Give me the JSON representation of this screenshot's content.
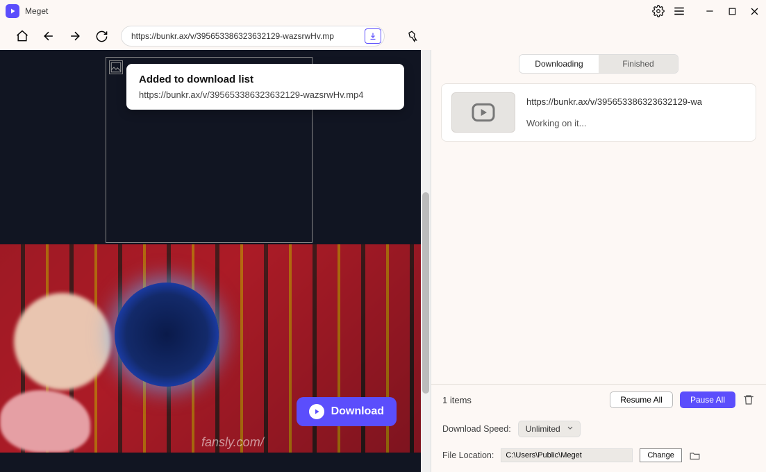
{
  "app": {
    "title": "Meget"
  },
  "nav": {
    "url": "https://bunkr.ax/v/395653386323632129-wazsrwHv.mp"
  },
  "toast": {
    "title": "Added to download list",
    "url": "https://bunkr.ax/v/395653386323632129-wazsrwHv.mp4"
  },
  "watermark": "fansly.com/",
  "download_button": "Download",
  "tabs": {
    "downloading": "Downloading",
    "finished": "Finished"
  },
  "downloads": [
    {
      "url": "https://bunkr.ax/v/395653386323632129-wa",
      "status": "Working on it..."
    }
  ],
  "footer": {
    "items": "1 items",
    "resume": "Resume All",
    "pause": "Pause All"
  },
  "settings": {
    "speed_label": "Download Speed:",
    "speed_value": "Unlimited",
    "location_label": "File Location:",
    "location_value": "C:\\Users\\Public\\Meget",
    "change": "Change"
  }
}
